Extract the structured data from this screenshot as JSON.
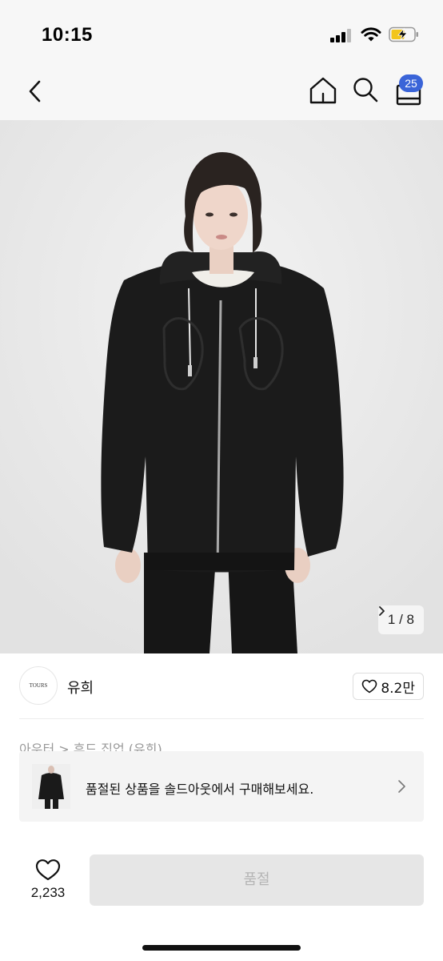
{
  "status_bar": {
    "time": "10:15"
  },
  "nav": {
    "back_icon": "chevron-left-icon",
    "home_icon": "home-icon",
    "search_icon": "search-icon",
    "bag_icon": "shopping-bag-icon",
    "bag_count": "25"
  },
  "product": {
    "image_index": "1 / 8",
    "shop": {
      "logo_text": "TOURS",
      "name": "유희"
    },
    "follow": {
      "label": "8.2만"
    },
    "breadcrumb": "아우터 > 후드 집업 (유희)"
  },
  "banner": {
    "text": "품절된 상품을 솔드아웃에서 구매해보세요."
  },
  "bottom_bar": {
    "like_count": "2,233",
    "soldout_label": "품절"
  },
  "colors": {
    "accent": "#3a64d8",
    "disabled_bg": "#e6e6e6",
    "disabled_text": "#b5b5b5"
  }
}
